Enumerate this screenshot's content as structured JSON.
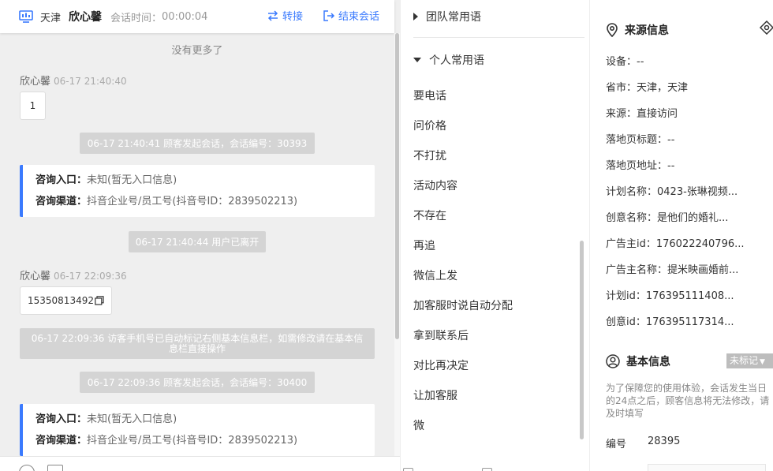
{
  "header": {
    "location": "天津",
    "visitor_name": "欣心馨",
    "session_time_label": "会话时间：",
    "session_time": "00:00:04",
    "transfer_label": "转接",
    "end_label": "结束会话"
  },
  "chat": {
    "no_more": "没有更多了",
    "messages": [
      {
        "sender": "欣心馨",
        "time": "06-17 21:40:40",
        "text": "1"
      },
      {
        "system": "06-17 21:40:41 顾客发起会话，会话编号：30393"
      },
      {
        "card": [
          {
            "k": "咨询入口：",
            "v": "未知(暂无入口信息)"
          },
          {
            "k": "咨询渠道：",
            "v": "抖音企业号/员工号(抖音号ID：2839502213)"
          }
        ]
      },
      {
        "system": "06-17 21:40:44 用户已离开"
      },
      {
        "sender": "欣心馨",
        "time": "06-17 22:09:36",
        "text": "15350813492"
      },
      {
        "system": "06-17 22:09:36 访客手机号已自动标记右侧基本信息栏，如需修改请在基本信息栏直接操作"
      },
      {
        "system": "06-17 22:09:36 顾客发起会话，会话编号：30400"
      },
      {
        "card": [
          {
            "k": "咨询入口：",
            "v": "未知(暂无入口信息)"
          },
          {
            "k": "咨询渠道：",
            "v": "抖音企业号/员工号(抖音号ID：2839502213)"
          }
        ]
      }
    ]
  },
  "phrases": {
    "team_group": "团队常用语",
    "personal_group": "个人常用语",
    "items": [
      "要电话",
      "问价格",
      "不打扰",
      "活动内容",
      "不存在",
      "再追",
      "微信上发",
      "加客服时说自动分配",
      "拿到联系后",
      "对比再决定",
      "让加客服",
      "微"
    ]
  },
  "source_info": {
    "title": "来源信息",
    "fields": [
      "设备：--",
      "省市：天津，天津",
      "来源：直接访问",
      "落地页标题：--",
      "落地页地址：--",
      "计划名称：0423-张琳视频...",
      "创意名称：是他们的婚礼...",
      "广告主id：176022240796...",
      "广告主名称：提米映画婚前...",
      "计划id：176395111408...",
      "创意id：176395117314..."
    ]
  },
  "basic_info": {
    "title": "基本信息",
    "badge": "未标记",
    "note": "为了保障您的使用体验，会话发生当日的24点之后，顾客信息将无法修改，请及时填写",
    "number_label": "编号",
    "number_value": "28395"
  },
  "colors": {
    "accent": "#3a7afe",
    "system_bg": "#d4d4d4",
    "badge_bg": "#bdbdbd"
  }
}
